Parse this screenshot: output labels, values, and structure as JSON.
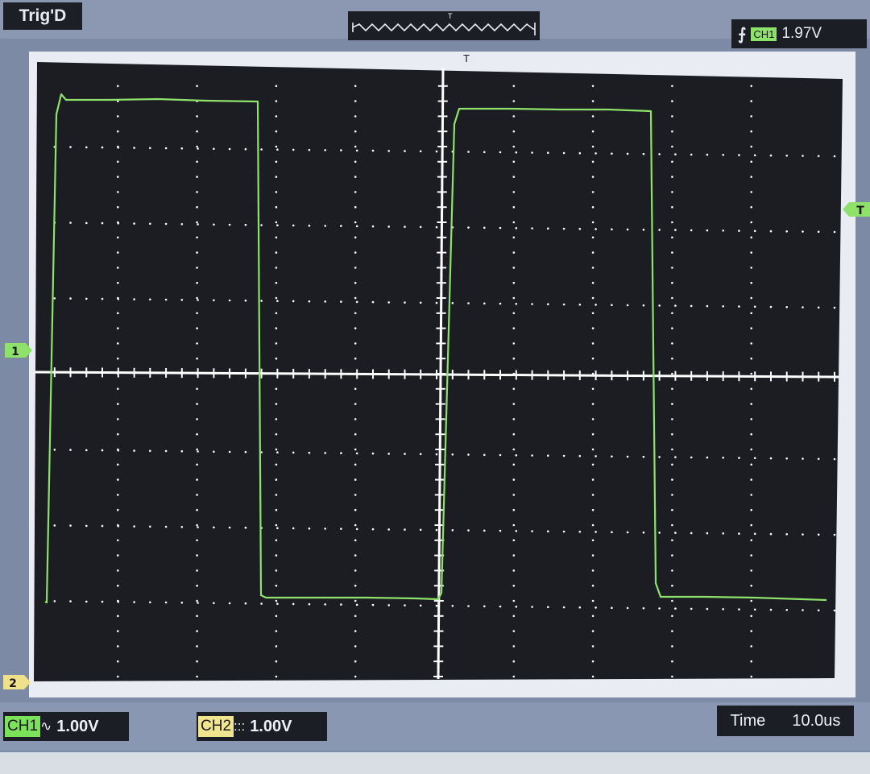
{
  "status": {
    "trigger_state": "Trig'D"
  },
  "trigger": {
    "edge_icon": "rising-edge-icon",
    "edge_glyph": "⨍",
    "source": "CH1",
    "level": "1.97V"
  },
  "markers": {
    "trigger_position": "T",
    "trigger_level": "T",
    "ch1_ground": "1",
    "ch2_ground": "2"
  },
  "channels": {
    "ch1": {
      "label": "CH1",
      "coupling_glyph": "∿",
      "scale": "1.00V"
    },
    "ch2": {
      "label": "CH2",
      "coupling_glyph": ":::",
      "scale": "1.00V"
    }
  },
  "timebase": {
    "label": "Time",
    "value": "10.0us"
  },
  "colors": {
    "trace_ch1": "#8ee26a",
    "grid": "#ffffff",
    "screen_bg": "#1b1d23",
    "ch2_marker": "#efe08a"
  }
}
